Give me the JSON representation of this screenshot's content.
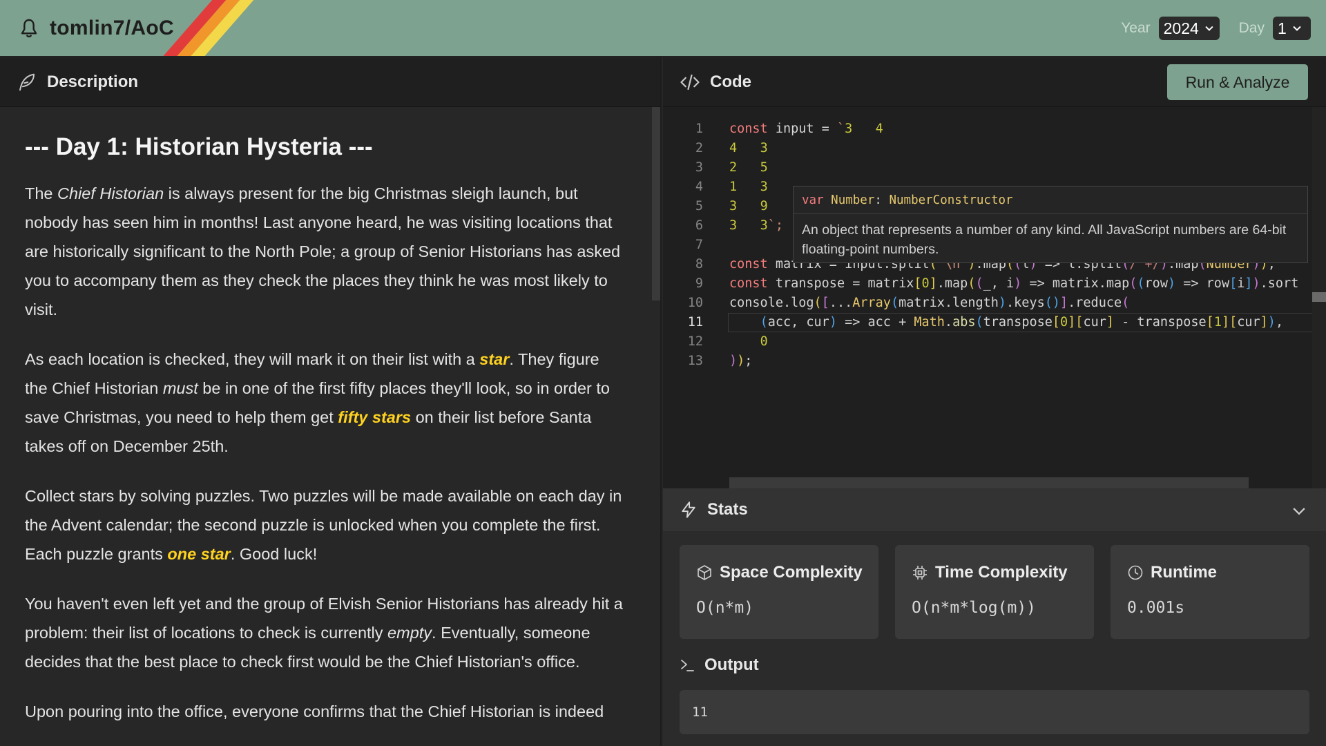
{
  "header": {
    "repo_title": "tomlin7/AoC",
    "year_label": "Year",
    "year_value": "2024",
    "day_label": "Day",
    "day_value": "1",
    "colors": {
      "bar": "#7da28f",
      "rainbow": [
        "#e23b3b",
        "#f0962b",
        "#f3d84a"
      ]
    }
  },
  "description": {
    "panel_title": "Description",
    "title": "--- Day 1: Historian Hysteria ---",
    "p1": {
      "t1": "The ",
      "em1": "Chief Historian",
      "t2": " is always present for the big Christmas sleigh launch, but nobody has seen him in months! Last anyone heard, he was visiting locations that are historically significant to the North Pole; a group of Senior Historians has asked you to accompany them as they check the places they think he was most likely to visit."
    },
    "p2": {
      "t1": "As each location is checked, they will mark it on their list with a ",
      "star1": "star",
      "t2": ". They figure the Chief Historian ",
      "em1": "must",
      "t3": " be in one of the first fifty places they'll look, so in order to save Christmas, you need to help them get ",
      "star2": "fifty stars",
      "t4": " on their list before Santa takes off on December 25th."
    },
    "p3": {
      "t1": "Collect stars by solving puzzles. Two puzzles will be made available on each day in the Advent calendar; the second puzzle is unlocked when you complete the first. Each puzzle grants ",
      "star1": "one star",
      "t2": ". Good luck!"
    },
    "p4": {
      "t1": "You haven't even left yet and the group of Elvish Senior Historians has already hit a problem: their list of locations to check is currently ",
      "em1": "empty",
      "t2": ". Eventually, someone decides that the best place to check first would be the Chief Historian's office."
    },
    "p5": {
      "t1": "Upon pouring into the office, everyone confirms that the Chief Historian is indeed"
    }
  },
  "code": {
    "panel_title": "Code",
    "run_label": "Run & Analyze",
    "line_numbers": [
      "1",
      "2",
      "3",
      "4",
      "5",
      "6",
      "7",
      "8",
      "9",
      "10",
      "11",
      "12",
      "13"
    ],
    "active_line": "11",
    "tokens": {
      "const": "const",
      "input": "input",
      "assign": " = ",
      "tpl_open": "`",
      "r1": "3   4",
      "r2a": "4",
      "r2b": "3",
      "r3a": "2",
      "r3b": "5",
      "r4a": "1",
      "r4b": "3",
      "r5a": "3",
      "r5b": "9",
      "r6a": "3",
      "r6b": "3",
      "tpl_close": "`;",
      "matrix": "matrix",
      "input_split": "input.split",
      "newline_str": "\"\\n\"",
      "map": ".map",
      "l_param": "l",
      "arrow": " => ",
      "l_split": "l.split",
      "regex": "/ +/",
      "Number": "Number",
      "close8": ");",
      "transpose": "transpose",
      "matrix0": "matrix",
      "zero": "0",
      "underscore": "_",
      "i_param": "i",
      "matrix_map": "matrix.map",
      "row": "row",
      "row_i": "row",
      "i_idx": "i",
      "sort": ".sort",
      "console_log": "console.log",
      "spread": "...",
      "Array": "Array",
      "matrix_length": "matrix.length",
      "keys": ".keys",
      "reduce": ".reduce",
      "acc": "acc",
      "cur": "cur",
      "acc_plus": " acc + ",
      "Math": "Math",
      "abs": "abs",
      "transpose_a": "transpose",
      "idx0": "0",
      "cur_a": "cur",
      "minus": " - ",
      "transpose_b": "transpose",
      "idx1": "1",
      "cur_b": "cur",
      "comma": ",",
      "init0": "0",
      "close13": ");"
    },
    "hover": {
      "sig_kw": "var",
      "sig_name": "Number",
      "sig_colon": ":",
      "sig_type": "NumberConstructor",
      "doc": "An object that represents a number of any kind. All JavaScript numbers are 64-bit floating-point numbers."
    }
  },
  "stats": {
    "title": "Stats",
    "cards": [
      {
        "label": "Space Complexity",
        "value": "O(n*m)",
        "icon": "cube-icon"
      },
      {
        "label": "Time Complexity",
        "value": "O(n*m*log(m))",
        "icon": "cpu-icon"
      },
      {
        "label": "Runtime",
        "value": "0.001s",
        "icon": "clock-icon"
      }
    ],
    "output_title": "Output",
    "output_value": "11"
  }
}
